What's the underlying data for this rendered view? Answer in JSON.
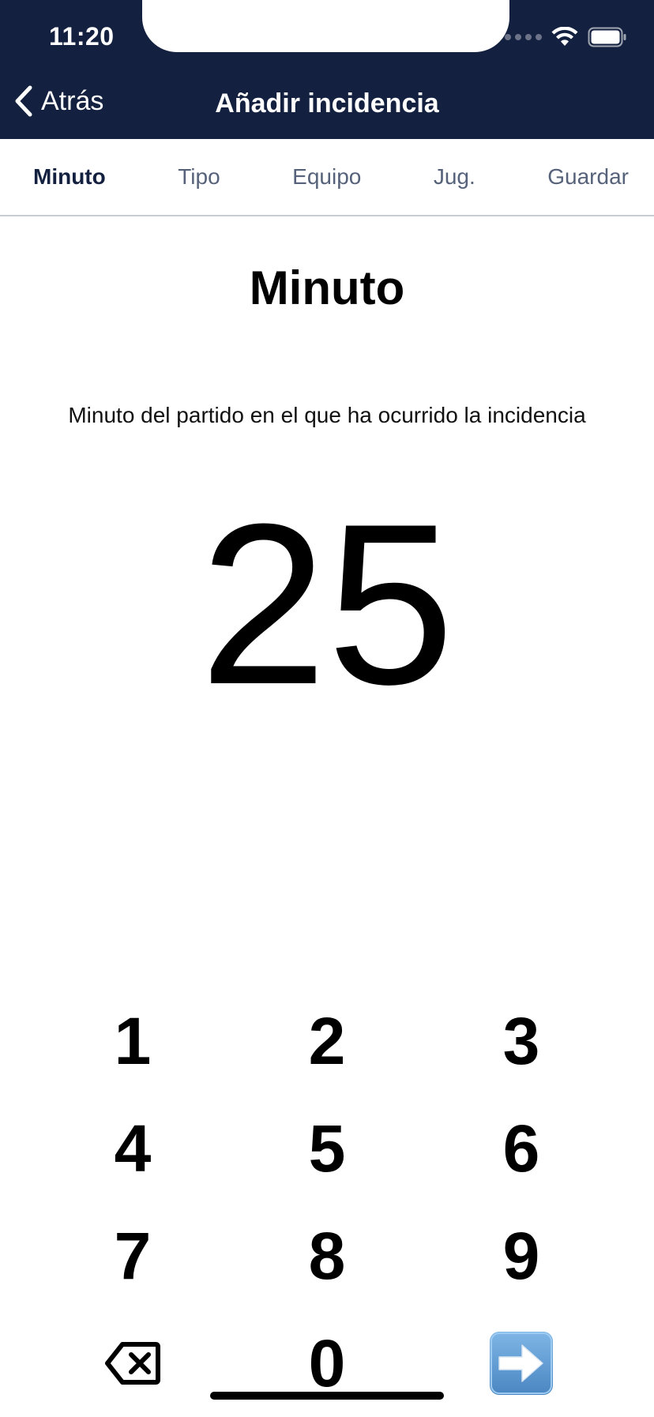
{
  "status_bar": {
    "time": "11:20"
  },
  "nav": {
    "back_label": "Atrás",
    "title": "Añadir incidencia"
  },
  "tabs": [
    {
      "label": "Minuto",
      "active": true
    },
    {
      "label": "Tipo",
      "active": false
    },
    {
      "label": "Equipo",
      "active": false
    },
    {
      "label": "Jug.",
      "active": false
    },
    {
      "label": "Guardar",
      "active": false
    }
  ],
  "content": {
    "title": "Minuto",
    "description": "Minuto del partido en el que ha ocurrido la incidencia",
    "value": "25"
  },
  "keypad": {
    "keys": [
      "1",
      "2",
      "3",
      "4",
      "5",
      "6",
      "7",
      "8",
      "9"
    ],
    "zero": "0",
    "delete_icon": "backspace-icon",
    "next_icon": "arrow-right-icon"
  },
  "colors": {
    "header_bg": "#13203f",
    "active_tab": "#13203f",
    "inactive_tab": "#56627a",
    "next_button": "#5b9bd5"
  }
}
